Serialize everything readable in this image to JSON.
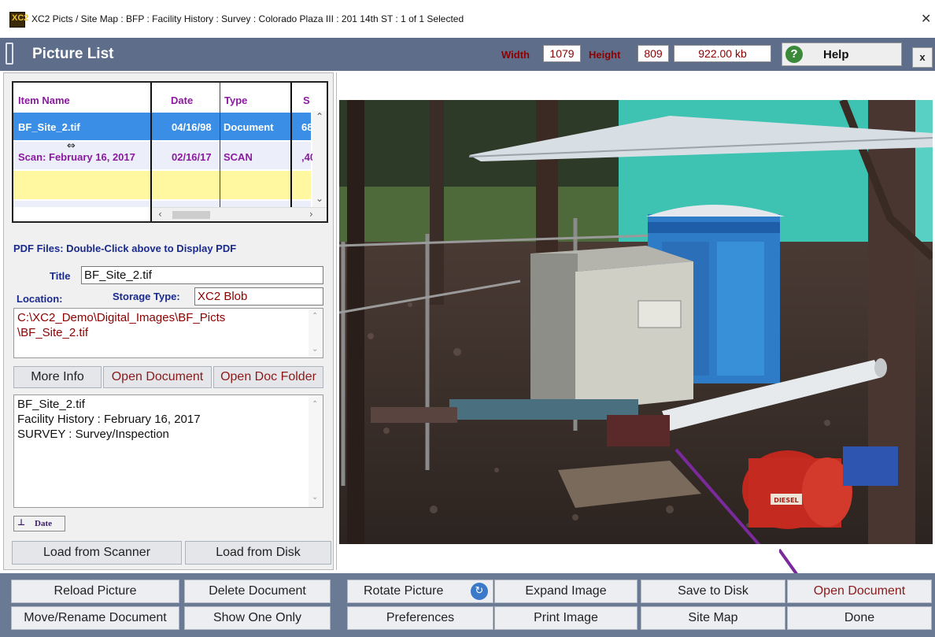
{
  "window": {
    "title": "XC2 Picts / Site Map :  BFP : Facility History : Survey : Colorado Plaza III : 201 14th ST : 1 of 1 Selected",
    "app_icon": "XC2"
  },
  "header": {
    "title": "Picture List",
    "width_label": "Width",
    "width_value": "1079",
    "height_label": "Height",
    "height_value": "809",
    "size_value": "922.00 kb",
    "help_label": "Help",
    "close_label": "x"
  },
  "grid": {
    "columns": [
      "Item Name",
      "Date",
      "Type",
      "S"
    ],
    "rows": [
      {
        "name": "BF_Site_2.tif",
        "date": "04/16/98",
        "type": "Document",
        "size": "68",
        "selected": true
      },
      {
        "name": "Scan: February 16, 2017",
        "date": "02/16/17",
        "type": "SCAN",
        "size": ",40",
        "selected": false
      }
    ]
  },
  "details": {
    "pdf_note": "PDF Files:  Double-Click above to Display PDF",
    "title_label": "Title",
    "title_value": "BF_Site_2.tif",
    "location_label": "Location:",
    "storage_type_label": "Storage Type:",
    "storage_type_value": "XC2 Blob",
    "path_line1": "C:\\XC2_Demo\\Digital_Images\\BF_Picts",
    "path_line2": "\\BF_Site_2.tif",
    "more_info": "More Info",
    "open_document": "Open Document",
    "open_doc_folder": "Open Doc Folder",
    "info_lines": [
      "BF_Site_2.tif",
      "Facility History  :  February 16, 2017",
      "SURVEY  :  Survey/Inspection"
    ],
    "date_button": "Date",
    "load_scanner": "Load from Scanner",
    "load_disk": "Load from Disk"
  },
  "photo": {
    "sign_text": "DIESEL"
  },
  "bottom": {
    "row1": [
      "Reload Picture",
      "Delete Document",
      "Rotate Picture",
      "Expand Image",
      "Save to Disk",
      "Open Document"
    ],
    "row2": [
      "Move/Rename Document",
      "Show One Only",
      "Preferences",
      "Print Image",
      "Site Map",
      "Done"
    ]
  },
  "colors": {
    "header_bg": "#5e6e8a",
    "selected_row": "#3a8ee6",
    "accent_red": "#8b0000",
    "label_blue": "#1a2a8c",
    "annotation_arrow": "#7a2a9c"
  }
}
